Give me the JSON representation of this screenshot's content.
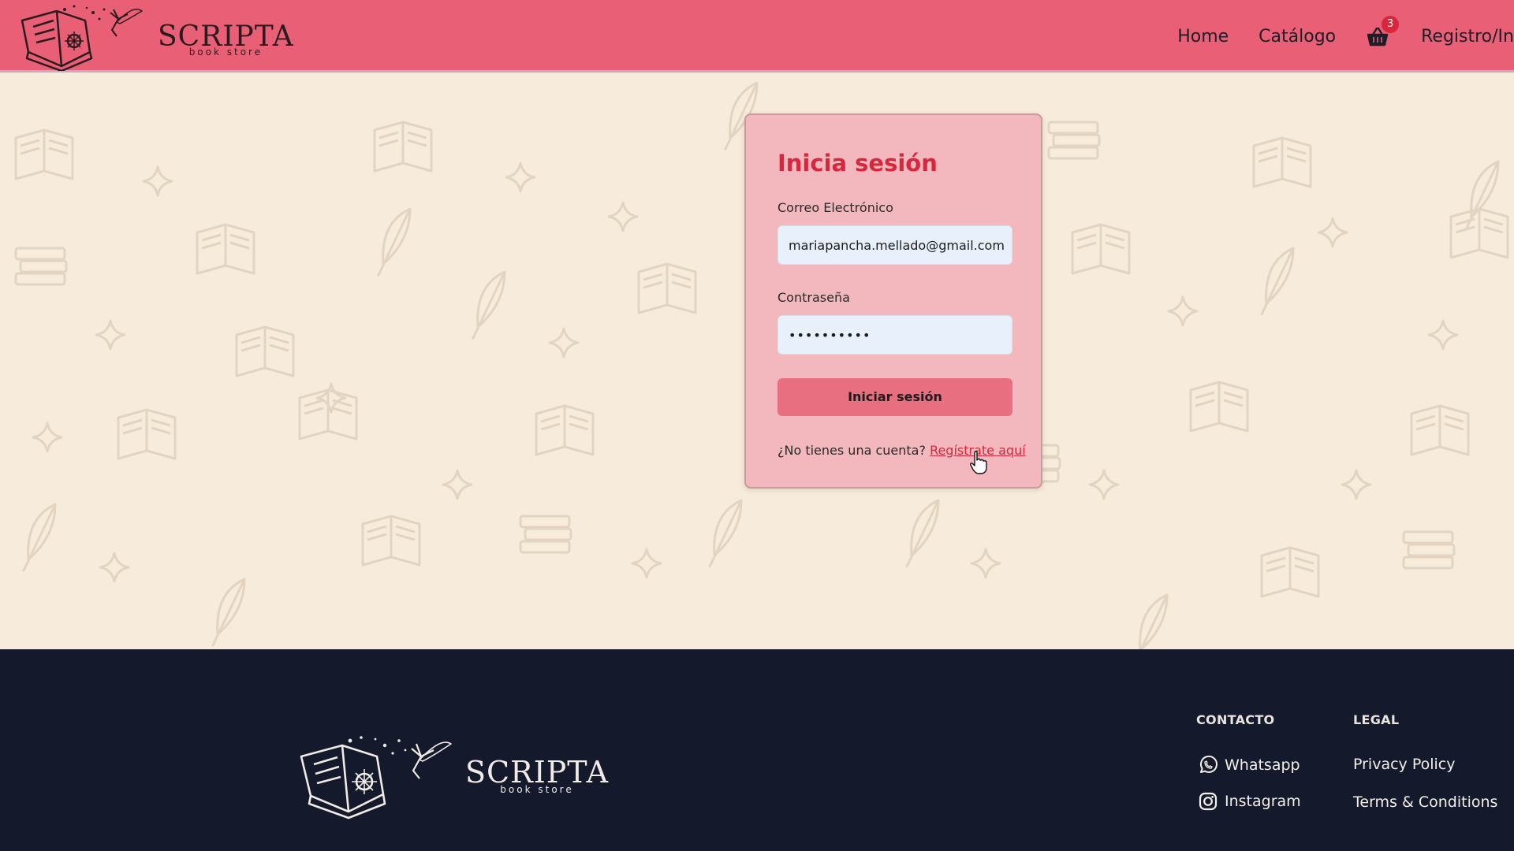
{
  "header": {
    "brand_name": "SCRIPTA",
    "brand_sub": "book store",
    "nav": {
      "home": "Home",
      "catalog": "Catálogo",
      "cart_count": "3",
      "register": "Registro/In"
    }
  },
  "login": {
    "title": "Inicia sesión",
    "email_label": "Correo Electrónico",
    "email_value": "mariapancha.mellado@gmail.com",
    "password_label": "Contraseña",
    "password_value": "••••••••••",
    "submit_label": "Iniciar sesión",
    "no_account_text": "¿No tienes una cuenta?",
    "register_link": "Regístrate aquí"
  },
  "footer": {
    "brand_name": "SCRIPTA",
    "brand_sub": "book store",
    "contact": {
      "title": "CONTACTO",
      "whatsapp": "Whatsapp",
      "instagram": "Instagram"
    },
    "legal": {
      "title": "LEGAL",
      "privacy": "Privacy Policy",
      "terms": "Terms & Conditions"
    }
  },
  "colors": {
    "header_bg": "#e95f75",
    "page_bg": "#f7ecdb",
    "card_bg": "#f3b8bd",
    "accent": "#d8263c",
    "button_bg": "#e86f80",
    "footer_bg": "#141a2c"
  },
  "icons": [
    "book-fairy-logo",
    "shopping-basket-icon",
    "whatsapp-icon",
    "instagram-icon",
    "hand-pointer-cursor"
  ]
}
